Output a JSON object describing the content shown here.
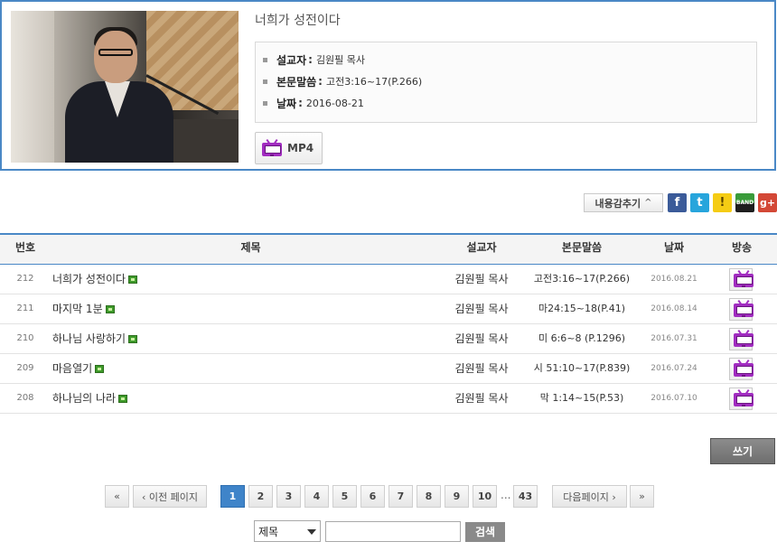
{
  "featured": {
    "title": "너희가 성전이다",
    "preacher_label": "설교자",
    "preacher": "김원필 목사",
    "verse_label": "본문말씀",
    "verse": "고전3:16~17(P.266)",
    "date_label": "날짜",
    "date": "2016-08-21",
    "media_label": "MP4"
  },
  "share": {
    "hide_label": "내용감추기",
    "icons": [
      "facebook-icon",
      "twitter-icon",
      "kakaostory-icon",
      "band-icon",
      "google-plus-icon"
    ],
    "band_text": "BAND"
  },
  "table": {
    "headers": {
      "num": "번호",
      "title": "제목",
      "preacher": "설교자",
      "verse": "본문말씀",
      "date": "날짜",
      "broadcast": "방송"
    },
    "rows": [
      {
        "num": "212",
        "title": "너희가 성전이다",
        "preacher": "김원필 목사",
        "verse": "고전3:16~17(P.266)",
        "date": "2016.08.21"
      },
      {
        "num": "211",
        "title": "마지막 1분",
        "preacher": "김원필 목사",
        "verse": "마24:15~18(P.41)",
        "date": "2016.08.14"
      },
      {
        "num": "210",
        "title": "하나님 사랑하기",
        "preacher": "김원필 목사",
        "verse": "미 6:6~8 (P.1296)",
        "date": "2016.07.31"
      },
      {
        "num": "209",
        "title": "마음열기",
        "preacher": "김원필 목사",
        "verse": "시 51:10~17(P.839)",
        "date": "2016.07.24"
      },
      {
        "num": "208",
        "title": "하나님의 나라",
        "preacher": "김원필 목사",
        "verse": "막 1:14~15(P.53)",
        "date": "2016.07.10"
      }
    ]
  },
  "write_label": "쓰기",
  "pagination": {
    "first": "«",
    "prev": "‹ 이전 페이지",
    "pages": [
      "1",
      "2",
      "3",
      "4",
      "5",
      "6",
      "7",
      "8",
      "9",
      "10"
    ],
    "current": "1",
    "ellipsis": "...",
    "last_page": "43",
    "next": "다음페이지 ›",
    "last": "»"
  },
  "search": {
    "field_selected": "제목",
    "query": "",
    "button_label": "검색"
  },
  "colors": {
    "accent": "#4a88c6",
    "active_page": "#3f84c9",
    "tv_icon": "#a12cc0"
  }
}
